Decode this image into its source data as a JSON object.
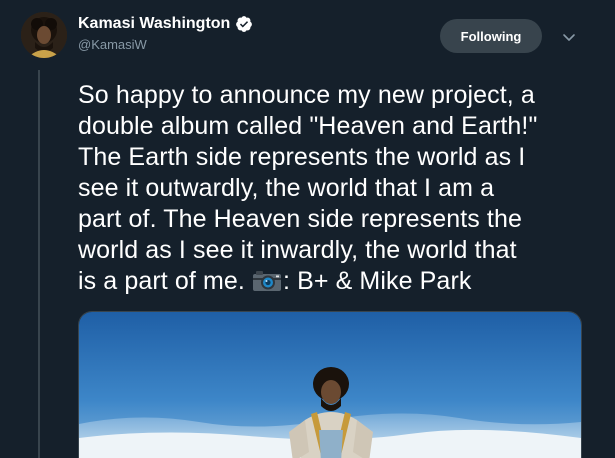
{
  "author": {
    "display_name": "Kamasi Washington",
    "handle": "@KamasiW",
    "verified_icon": "verified-badge-icon"
  },
  "actions": {
    "follow_label": "Following",
    "more_icon": "chevron-down-icon"
  },
  "tweet": {
    "lines": [
      "So happy to announce my new project, a",
      "double album called \"Heaven and Earth!\"",
      "The Earth side represents the world as I",
      "see it outwardly, the world that I am a",
      "part of. The Heaven side represents the",
      "world as I see it inwardly, the world that",
      "is a part of me.",
      ": B+ & Mike Park"
    ],
    "emoji_icon": "camera-icon"
  },
  "colors": {
    "background": "#15202b",
    "text": "#ffffff",
    "secondary_text": "#8899a6",
    "button_bg": "#38444d",
    "verified": "#1da1f2"
  }
}
